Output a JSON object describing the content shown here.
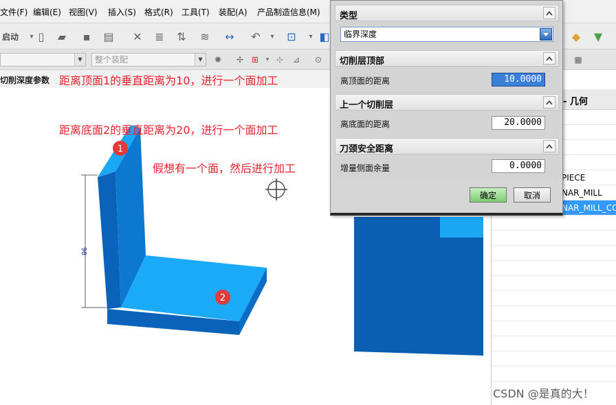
{
  "menu": {
    "items": [
      "文件(F)",
      "编辑(E)",
      "视图(V)",
      "插入(S)",
      "格式(R)",
      "工具(T)",
      "装配(A)",
      "产品制造信息(M)"
    ]
  },
  "toolbar": {
    "start_label": "启动"
  },
  "filterbar": {
    "assembly_combo": "整个装配"
  },
  "status": {
    "prompt": "切削深度参数"
  },
  "annotations": {
    "a1": "距离顶面1的垂直距离为10，进行一个面加工",
    "a2": "距离底面2的垂直距离为20，进行一个面加工",
    "a3": "假想有一个面，然后进行加工"
  },
  "shape": {
    "dimension": "90",
    "marker1": "1",
    "marker2": "2"
  },
  "tree": {
    "header": "- 几何",
    "rows": [
      "PIECE",
      "NAR_MILL",
      "NAR_MILL_CO"
    ]
  },
  "dialog": {
    "type": {
      "header": "类型",
      "value": "临界深度"
    },
    "top": {
      "header": "切削层顶部",
      "label": "离顶面的距离",
      "value": "10.0000"
    },
    "prev": {
      "header": "上一个切削层",
      "label": "离底面的距离",
      "value": "20.0000"
    },
    "neck": {
      "header": "刀颈安全距离",
      "label": "增量侧面余量",
      "value": "0.0000"
    },
    "ok": "确定",
    "cancel": "取消"
  },
  "watermark": "CSDN @是真的大！",
  "colors": {
    "annotation": "#e8222d",
    "shape_face_light": "#1aa8f5",
    "shape_face_dark": "#0a63b8",
    "marker": "#e23a3a",
    "selection": "#3399ff"
  }
}
